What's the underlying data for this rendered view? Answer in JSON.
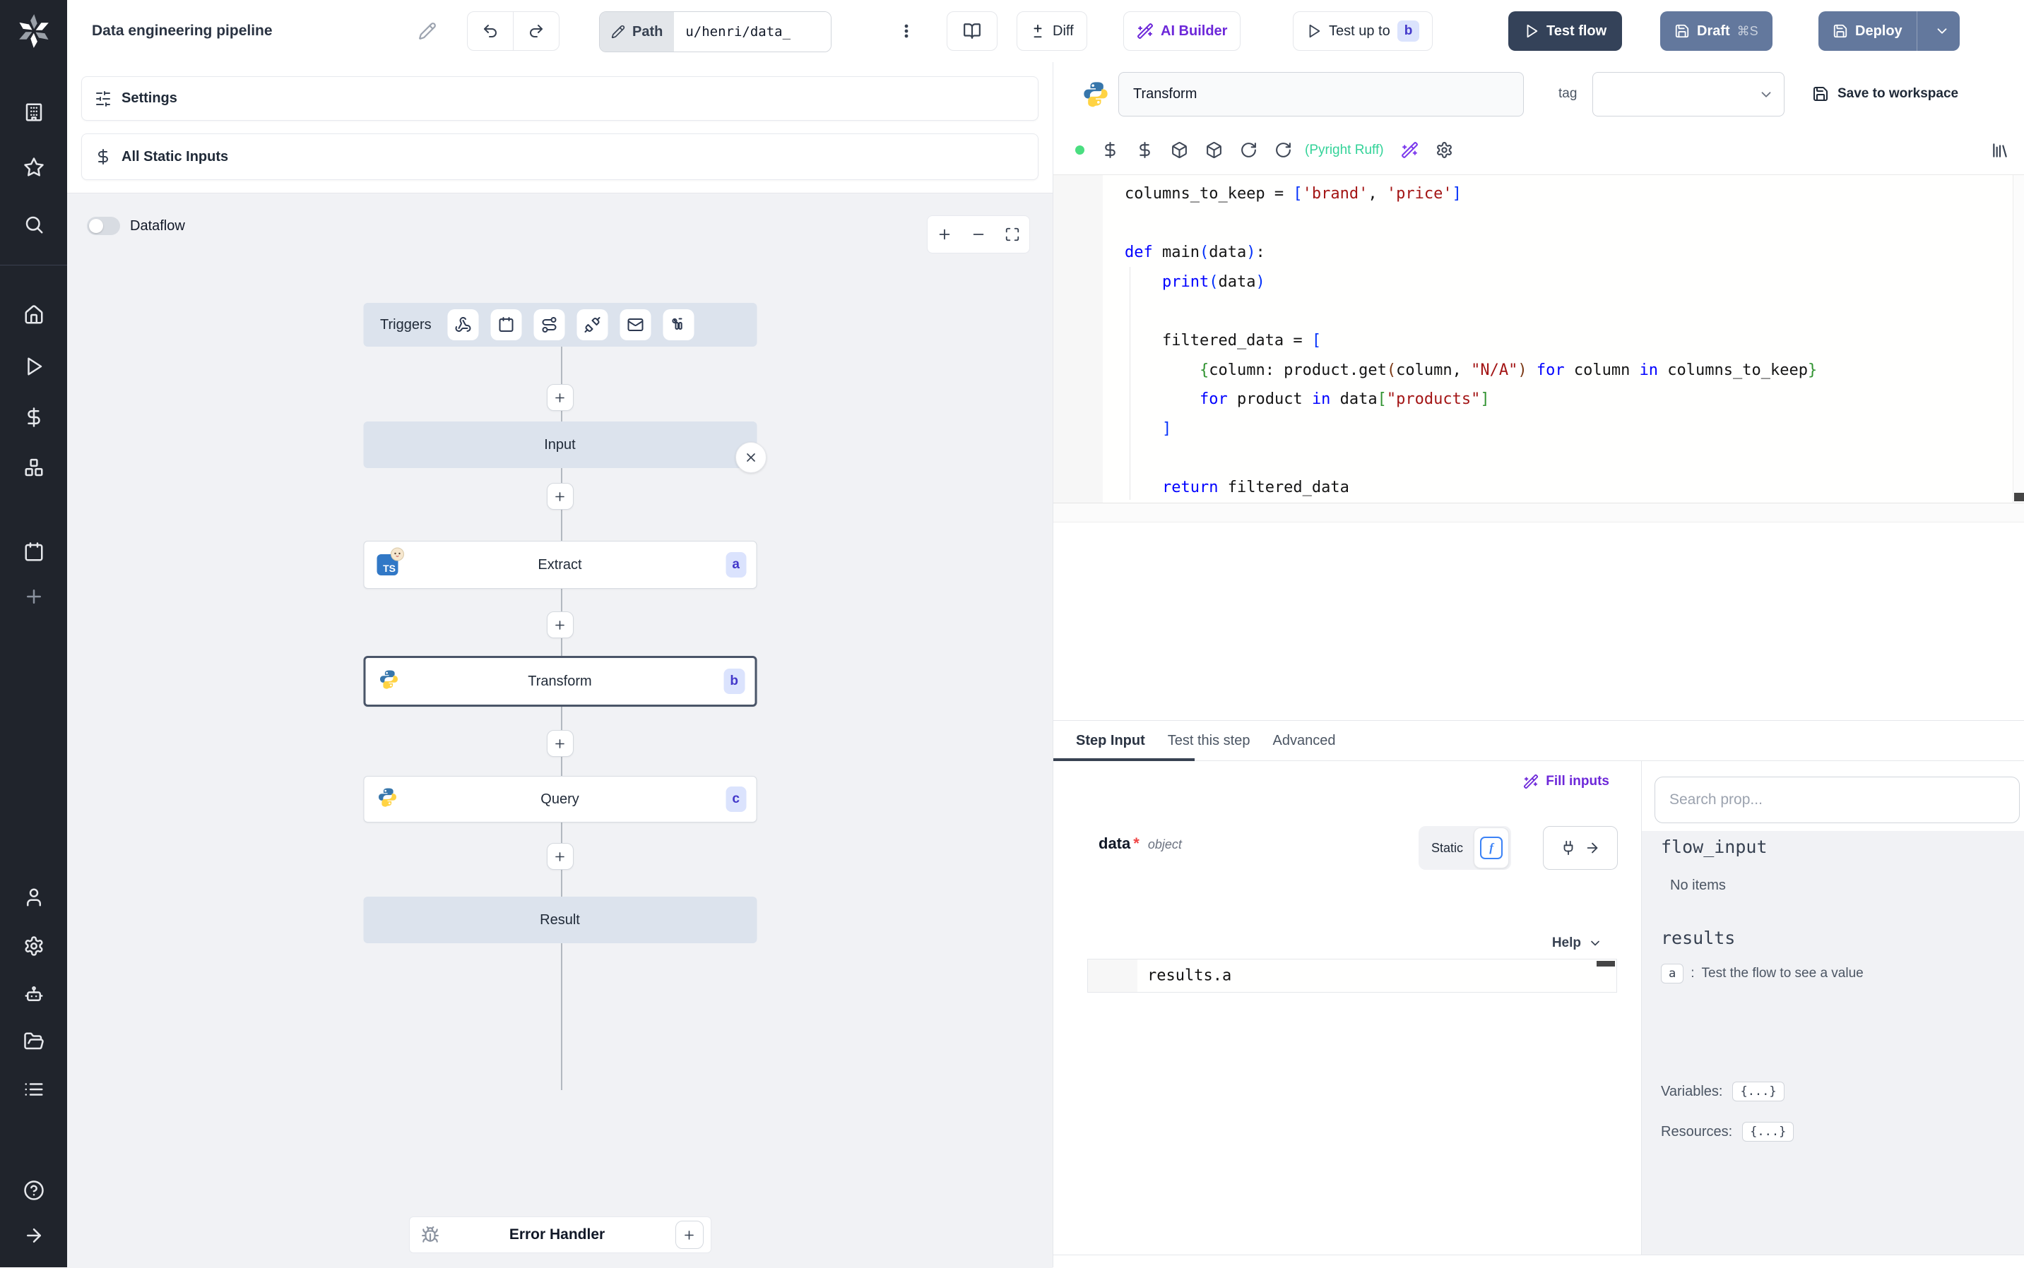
{
  "topbar": {
    "title": "Data engineering pipeline",
    "path_label": "Path",
    "path_value": "u/henri/data_",
    "diff": "Diff",
    "ai_builder": "AI Builder",
    "test_up_to": "Test up to",
    "test_up_to_badge": "b",
    "test_flow": "Test flow",
    "draft": "Draft",
    "draft_shortcut": "⌘S",
    "deploy": "Deploy"
  },
  "left_panel": {
    "settings": "Settings",
    "all_static_inputs": "All Static Inputs",
    "dataflow": "Dataflow"
  },
  "flow": {
    "triggers_label": "Triggers",
    "input_label": "Input",
    "result_label": "Result",
    "error_handler_label": "Error Handler",
    "steps": [
      {
        "label": "Extract",
        "badge": "a",
        "lang": "bun"
      },
      {
        "label": "Transform",
        "badge": "b",
        "lang": "python"
      },
      {
        "label": "Query",
        "badge": "c",
        "lang": "python"
      }
    ]
  },
  "editor": {
    "step_name": "Transform",
    "tag_label": "tag",
    "save_to_workspace": "Save to workspace",
    "lint_status": "(Pyright Ruff)",
    "code": [
      [
        {
          "t": "columns_to_keep = ",
          "c": "p"
        },
        {
          "t": "[",
          "c": "b1"
        },
        {
          "t": "'brand'",
          "c": "s"
        },
        {
          "t": ", ",
          "c": "p"
        },
        {
          "t": "'price'",
          "c": "s"
        },
        {
          "t": "]",
          "c": "b1"
        }
      ],
      [],
      [
        {
          "t": "def",
          "c": "k"
        },
        {
          "t": " main",
          "c": "p"
        },
        {
          "t": "(",
          "c": "b1"
        },
        {
          "t": "data",
          "c": "p"
        },
        {
          "t": ")",
          "c": "b1"
        },
        {
          "t": ":",
          "c": "p"
        }
      ],
      [
        {
          "t": "    ",
          "c": "p"
        },
        {
          "t": "print",
          "c": "k"
        },
        {
          "t": "(",
          "c": "b1"
        },
        {
          "t": "data",
          "c": "p"
        },
        {
          "t": ")",
          "c": "b1"
        }
      ],
      [],
      [
        {
          "t": "    filtered_data = ",
          "c": "p"
        },
        {
          "t": "[",
          "c": "b1"
        }
      ],
      [
        {
          "t": "        ",
          "c": "p"
        },
        {
          "t": "{",
          "c": "b2"
        },
        {
          "t": "column: product.get",
          "c": "p"
        },
        {
          "t": "(",
          "c": "b3"
        },
        {
          "t": "column, ",
          "c": "p"
        },
        {
          "t": "\"N/A\"",
          "c": "s"
        },
        {
          "t": ")",
          "c": "b3"
        },
        {
          "t": " ",
          "c": "p"
        },
        {
          "t": "for",
          "c": "k"
        },
        {
          "t": " column ",
          "c": "p"
        },
        {
          "t": "in",
          "c": "k"
        },
        {
          "t": " columns_to_keep",
          "c": "p"
        },
        {
          "t": "}",
          "c": "b2"
        }
      ],
      [
        {
          "t": "        ",
          "c": "p"
        },
        {
          "t": "for",
          "c": "k"
        },
        {
          "t": " product ",
          "c": "p"
        },
        {
          "t": "in",
          "c": "k"
        },
        {
          "t": " data",
          "c": "p"
        },
        {
          "t": "[",
          "c": "b2"
        },
        {
          "t": "\"products\"",
          "c": "s"
        },
        {
          "t": "]",
          "c": "b2"
        }
      ],
      [
        {
          "t": "    ",
          "c": "p"
        },
        {
          "t": "]",
          "c": "b1"
        }
      ],
      [],
      [
        {
          "t": "    ",
          "c": "p"
        },
        {
          "t": "return",
          "c": "k"
        },
        {
          "t": " filtered_data",
          "c": "p"
        }
      ]
    ]
  },
  "step_panel": {
    "tabs": [
      "Step Input",
      "Test this step",
      "Advanced"
    ],
    "active_tab": "Step Input",
    "fill_inputs": "Fill inputs",
    "arg_name": "data",
    "arg_required": "*",
    "arg_type": "object",
    "static_label": "Static",
    "expression": "results.a",
    "help_label": "Help"
  },
  "props_panel": {
    "search_placeholder": "Search prop...",
    "flow_input_label": "flow_input",
    "no_items": "No items",
    "results_label": "results",
    "result_key": "a",
    "result_colon": ":",
    "result_hint": "Test the flow to see a value",
    "variables_label": "Variables:",
    "resources_label": "Resources:",
    "object_chip": "{...}"
  },
  "colors": {
    "rail_bg": "#20242c",
    "canvas_bg": "#f1f2f5",
    "steel_node": "#dce3ed",
    "primary_button": "#344259",
    "secondary_button": "#63789d",
    "badge_bg": "#dbe3fd",
    "badge_text": "#4338ca",
    "ai_purple": "#6d28d9",
    "lint_green": "#34d399",
    "status_dot": "#4ade80"
  }
}
